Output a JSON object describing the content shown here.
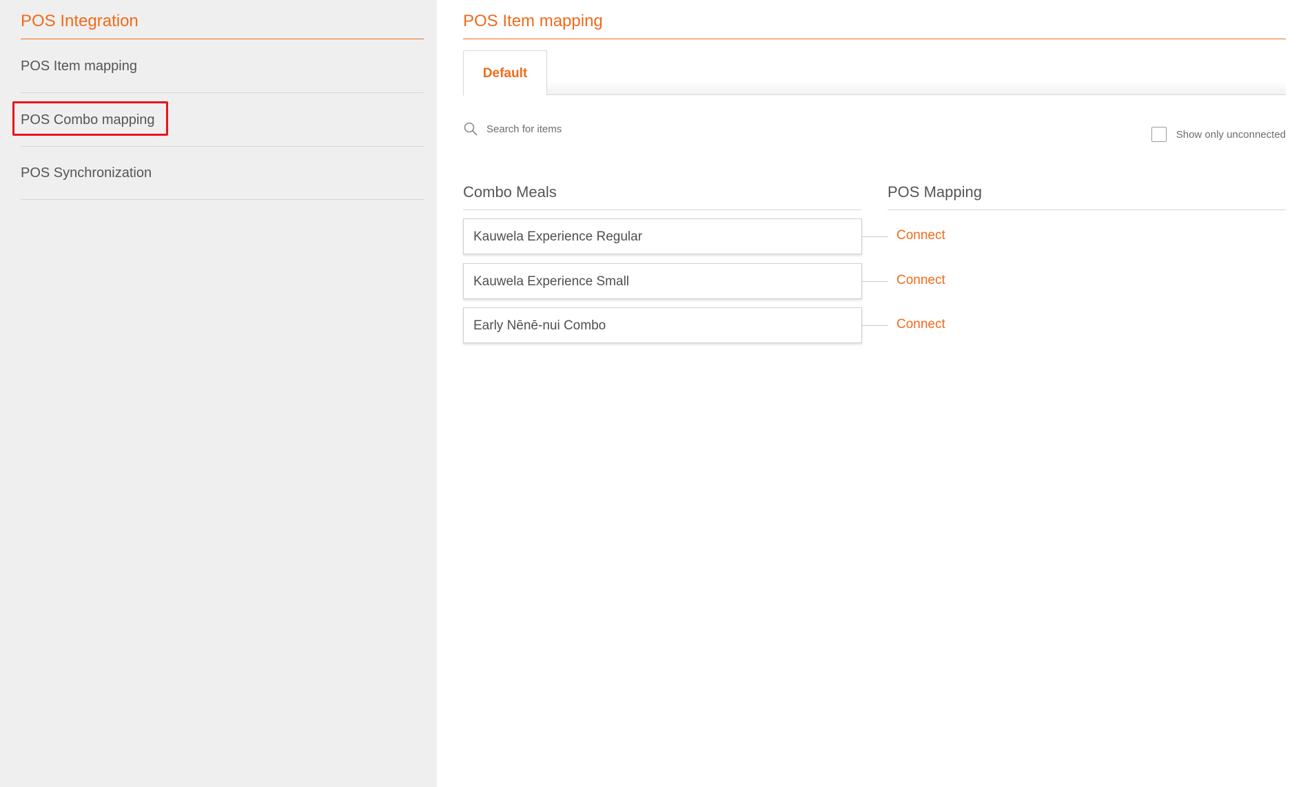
{
  "sidebar": {
    "title": "POS Integration",
    "items": [
      {
        "label": "POS Item mapping"
      },
      {
        "label": "POS Combo mapping"
      },
      {
        "label": "POS Synchronization"
      }
    ]
  },
  "main": {
    "title": "POS Item mapping",
    "tabs": [
      {
        "label": "Default"
      }
    ],
    "search": {
      "placeholder": "Search for items",
      "value": ""
    },
    "filter": {
      "label": "Show only unconnected",
      "checked": false
    },
    "columns": {
      "left": "Combo Meals",
      "right": "POS Mapping"
    },
    "rows": [
      {
        "name": "Kauwela Experience Regular",
        "action": "Connect"
      },
      {
        "name": "Kauwela Experience Small",
        "action": "Connect"
      },
      {
        "name": "Early Nēnē-nui Combo",
        "action": "Connect"
      }
    ]
  },
  "colors": {
    "accent": "#f06a1a",
    "highlight": "#e8141a",
    "sidebar_bg": "#efefef"
  },
  "icons": {
    "search": "search-icon"
  }
}
